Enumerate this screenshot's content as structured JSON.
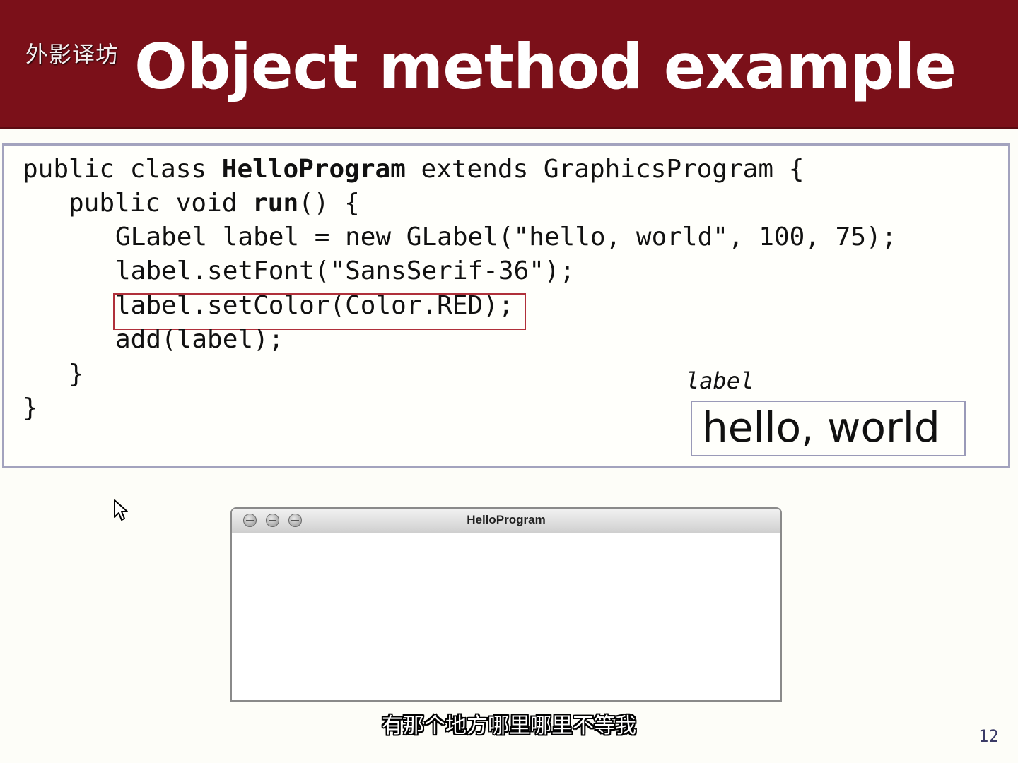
{
  "header": {
    "watermark": "外影译坊",
    "title": "Object method example"
  },
  "code": {
    "line1": {
      "a": "public class ",
      "b": "HelloProgram",
      "c": " extends GraphicsProgram {"
    },
    "line2": {
      "a": "public void ",
      "b": "run",
      "c": "() {"
    },
    "line3": "GLabel label = new GLabel(\"hello, world\", 100, 75);",
    "line4": "label.setFont(\"SansSerif-36\");",
    "line5": "label.setColor(Color.RED);",
    "line6": "add(label);",
    "line7": "}",
    "line8": "}"
  },
  "variable": {
    "name": "label",
    "value": "hello, world"
  },
  "window": {
    "title": "HelloProgram"
  },
  "subtitle": "有那个地方哪里哪里不等我",
  "page_number": "12",
  "colors": {
    "header_bg": "#7b1019",
    "highlight_border": "#b0303a",
    "box_border": "#a3a3be"
  }
}
